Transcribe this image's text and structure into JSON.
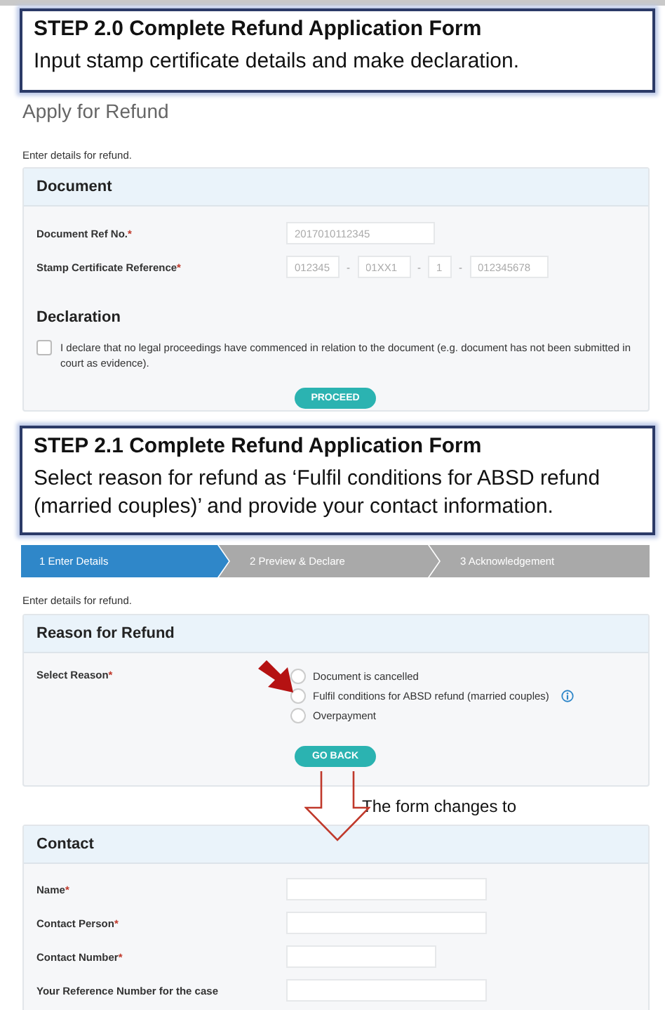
{
  "step_2_0": {
    "title": "STEP 2.0 Complete Refund Application Form",
    "text": "Input stamp certificate details and make declaration."
  },
  "apply_form": {
    "page_title": "Apply for Refund",
    "intro": "Enter details for refund.",
    "document": {
      "title": "Document",
      "fields": [
        {
          "label": "Document Ref No.",
          "mark": "*",
          "parts": [
            {
              "kind": "field",
              "placeholder": "2017010112345"
            }
          ]
        },
        {
          "label": "Stamp Certificate Reference",
          "mark": "*",
          "parts": [
            {
              "kind": "field",
              "placeholder": "012345"
            },
            {
              "kind": "separator",
              "text": "-"
            },
            {
              "kind": "field",
              "placeholder": "01XX1"
            },
            {
              "kind": "separator",
              "text": "-"
            },
            {
              "kind": "field",
              "placeholder": "1"
            },
            {
              "kind": "separator",
              "text": "-"
            },
            {
              "kind": "field",
              "placeholder": "012345678"
            }
          ]
        }
      ]
    },
    "declaration": {
      "title": "Declaration",
      "text": "I declare that no legal proceedings have commenced in relation to the document (e.g. document has not been submitted in court as evidence).",
      "checked": false
    },
    "button": "PROCEED"
  },
  "step_2_1": {
    "title": "STEP 2.1 Complete Refund Application Form",
    "text": "Select reason for refund as ‘Fulfil conditions for ABSD refund (married couples)’ and provide your contact information."
  },
  "stepper": [
    {
      "label": "1 Enter Details",
      "selected": true
    },
    {
      "label": "2 Preview & Declare",
      "selected": false
    },
    {
      "label": "3 Acknowledgement",
      "selected": false
    }
  ],
  "reason_form": {
    "intro": "Enter details for refund.",
    "title": "Reason for Refund",
    "label": "Select Reason",
    "mark": "*",
    "options": [
      {
        "label": "Document is cancelled",
        "selected": false,
        "info": false
      },
      {
        "label": "Fulfil conditions for ABSD refund (married couples)",
        "selected": false,
        "info": true
      },
      {
        "label": "Overpayment",
        "selected": false,
        "info": false
      }
    ],
    "button": "GO BACK"
  },
  "annotation": {
    "text": "The form changes to"
  },
  "contact": {
    "title": "Contact",
    "fields": [
      {
        "label": "Name",
        "mark": "*"
      },
      {
        "label": "Contact Person",
        "mark": "*"
      },
      {
        "label": "Contact Number",
        "mark": "*"
      },
      {
        "label": "Your Reference Number for the case"
      }
    ]
  }
}
